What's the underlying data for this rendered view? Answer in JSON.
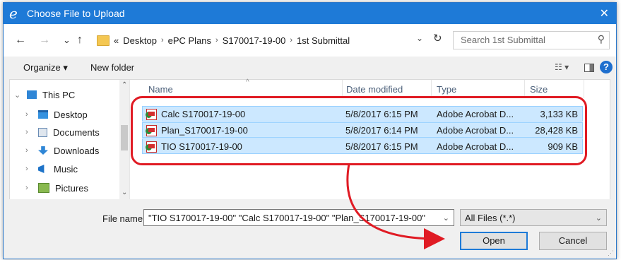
{
  "window": {
    "title": "Choose File to Upload",
    "close_glyph": "✕"
  },
  "address": {
    "back": "←",
    "forward": "→",
    "recent": "⌄",
    "up": "↑",
    "overflow": "«",
    "crumbs": [
      "Desktop",
      "ePC Plans",
      "S170017-19-00",
      "1st Submittal"
    ],
    "crumb_sep": "›",
    "dropdown": "⌄",
    "refresh": "↻",
    "search_placeholder": "Search 1st Submittal",
    "search_glyph": "⚲"
  },
  "toolbar": {
    "organize": "Organize ▾",
    "new_folder": "New folder",
    "view": "☷ ▾",
    "help": "?"
  },
  "nav": {
    "root": {
      "label": "This PC",
      "chev": "⌄"
    },
    "items": [
      {
        "label": "Desktop",
        "chev": "›"
      },
      {
        "label": "Documents",
        "chev": "›"
      },
      {
        "label": "Downloads",
        "chev": "›"
      },
      {
        "label": "Music",
        "chev": "›"
      },
      {
        "label": "Pictures",
        "chev": "›"
      }
    ],
    "scroll_up": "⌃",
    "scroll_down": "⌄"
  },
  "columns": {
    "name": "Name",
    "date": "Date modified",
    "type": "Type",
    "size": "Size",
    "sort": "^"
  },
  "files": [
    {
      "name": "Calc S170017-19-00",
      "date": "5/8/2017 6:15 PM",
      "type": "Adobe Acrobat D...",
      "size": "3,133 KB"
    },
    {
      "name": "Plan_S170017-19-00",
      "date": "5/8/2017 6:14 PM",
      "type": "Adobe Acrobat D...",
      "size": "28,428 KB"
    },
    {
      "name": "TIO S170017-19-00",
      "date": "5/8/2017 6:15 PM",
      "type": "Adobe Acrobat D...",
      "size": "909 KB"
    }
  ],
  "bottom": {
    "file_name_label": "File name:",
    "file_name_value": "\"TIO S170017-19-00\" \"Calc S170017-19-00\" \"Plan_S170017-19-00\"",
    "dropdown": "⌄",
    "filter": "All Files (*.*)",
    "open": "Open",
    "cancel": "Cancel"
  },
  "colors": {
    "accent": "#1e7ad7",
    "selection": "#cce8ff",
    "annotation": "#e01b24"
  }
}
